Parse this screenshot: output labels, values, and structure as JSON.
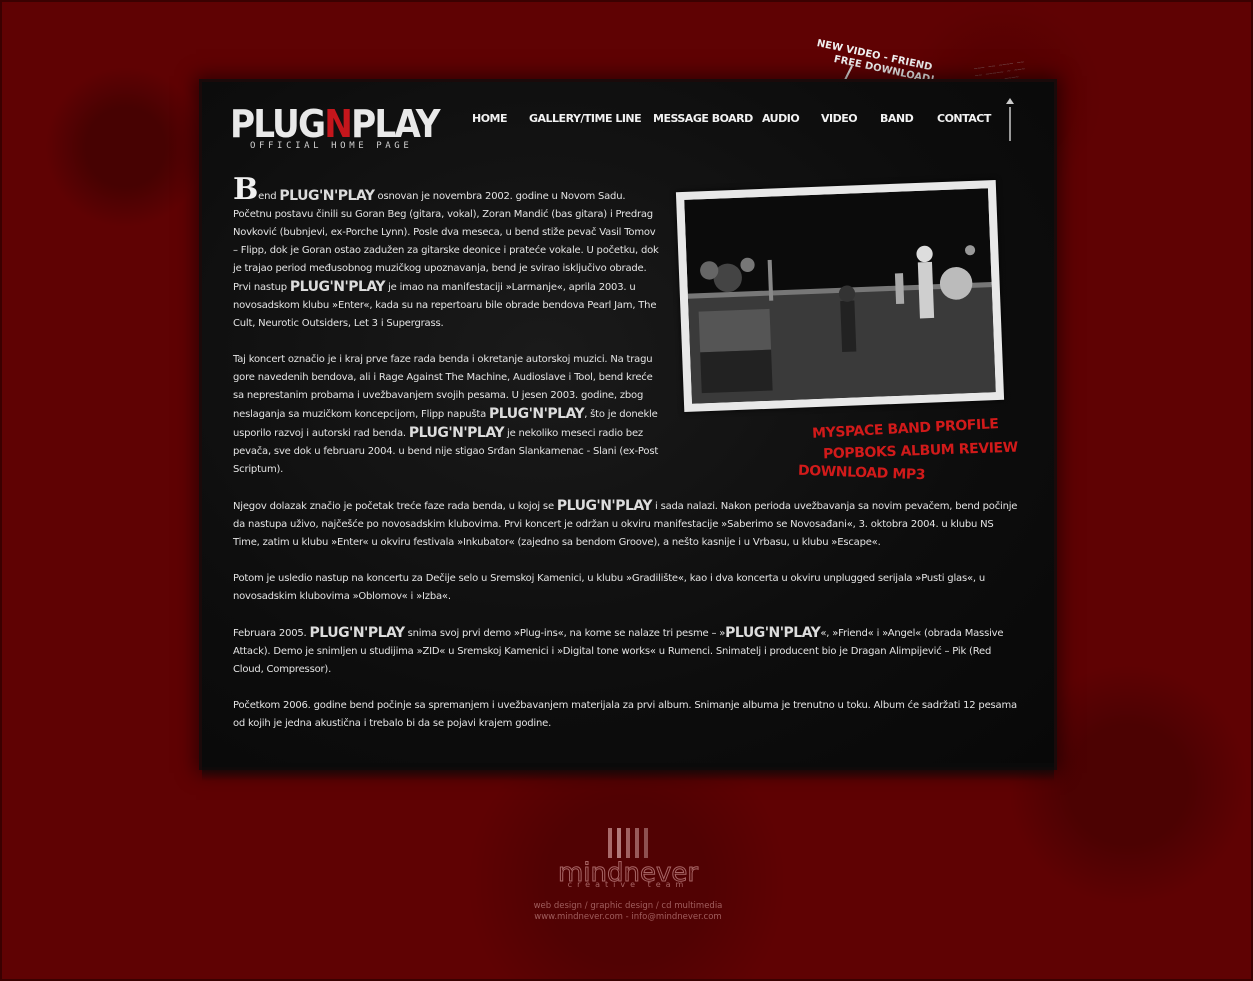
{
  "logo": {
    "part1": "PLUG",
    "accent": "N",
    "part2": "PLAY",
    "subtitle": "OFFICIAL HOME PAGE"
  },
  "nav": [
    "HOME",
    "GALLERY/TIME LINE",
    "MESSAGE BOARD",
    "AUDIO",
    "VIDEO",
    "BAND",
    "CONTACT"
  ],
  "promo": {
    "line1": "NEW VIDEO - FRIEND",
    "line2": "FREE DOWNLOAD!"
  },
  "brand_word": "PLUG'N'PLAY",
  "article": {
    "p1_dropcap": "B",
    "p1_a": "end",
    "p1_b": "osnovan je novembra 2002. godine u Novom Sadu. Početnu postavu činili su Goran Beg (gitara, vokal), Zoran Mandić (bas gitara) i Predrag Novković (bubnjevi, ex-Porche Lynn). Posle dva meseca, u bend stiže pevač Vasil Tomov – Flipp, dok je Goran ostao zadužen za gitarske deonice i prateće vokale. U početku, dok je trajao period međusobnog muzičkog upoznavanja, bend je svirao isključivo obrade. Prvi nastup",
    "p1_c": "je imao na manifestaciji »Larmanje«, aprila 2003. u novosadskom klubu »Enter«, kada su na repertoaru bile obrade bendova Pearl Jam, The Cult, Neurotic Outsiders, Let 3 i Supergrass.",
    "p2_a": "Taj koncert označio je i kraj prve faze rada benda i okretanje autorskoj muzici. Na tragu gore navedenih bendova, ali i Rage Against The Machine, Audioslave i Tool, bend kreće sa neprestanim probama i uvežbavanjem svojih pesama. U jesen 2003. godine, zbog neslaganja sa muzičkom koncepcijom, Flipp napušta",
    "p2_b": ", što je donekle usporilo razvoj i autorski rad benda.",
    "p2_c": "je nekoliko meseci radio bez pevača, sve dok u februaru 2004. u bend nije stigao Srđan Slankamenac - Slani (ex-Post Scriptum).",
    "p3_a": "Njegov dolazak značio je početak treće faze rada benda, u kojoj se",
    "p3_b": "i sada nalazi. Nakon perioda uvežbavanja sa novim pevačem, bend počinje da nastupa uživo, najčešće po novosadskim klubovima. Prvi koncert je održan u okviru manifestacije »Saberimo se Novosađani«, 3. oktobra 2004. u klubu NS Time, zatim u klubu »Enter« u okviru festivala »Inkubator« (zajedno sa bendom Groove), a nešto kasnije i u Vrbasu, u klubu »Escape«.",
    "p4": "Potom je usledio nastup na koncertu za Dečije selo u Sremskoj Kamenici, u klubu »Gradilište«, kao i dva koncerta u okviru unplugged serijala »Pusti glas«, u novosadskim klubovima »Oblomov« i »Izba«.",
    "p5_a": "Februara 2005.",
    "p5_b": "snima svoj prvi demo »Plug-ins«, na kome se nalaze tri pesme – »",
    "p5_c": "«, »Friend« i »Angel« (obrada Massive Attack). Demo je snimljen u studijima »ZID« u Sremskoj Kamenici i »Digital tone works« u Rumenci. Snimatelj i producent bio je Dragan Alimpijević – Pik (Red Cloud, Compressor).",
    "p6": "Početkom 2006. godine bend počinje sa spremanjem i uvežbavanjem materijala za prvi album. Snimanje albuma je trenutno u toku. Album će sadržati 12 pesama od kojih je jedna akustična i trebalo bi da se pojavi krajem godine."
  },
  "links": {
    "myspace": "MYSPACE BAND PROFILE",
    "popboks": "POPBOKS ALBUM REVIEW",
    "download": "DOWNLOAD MP3"
  },
  "footer": {
    "logo": "mindnever",
    "tagline": "creative team",
    "line1": "web design / graphic design / cd multimedia",
    "line2": "www.mindnever.com - info@mindnever.com"
  },
  "colors": {
    "background": "#5e0203",
    "panel": "#0d0d0d",
    "accent_red": "#d11a1a",
    "footer": "#a86666"
  }
}
